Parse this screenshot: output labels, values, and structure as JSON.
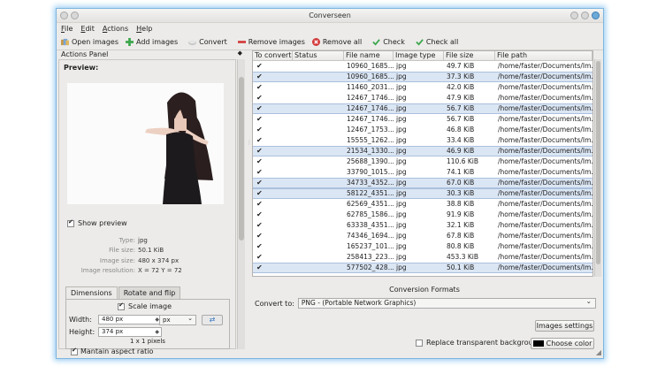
{
  "window": {
    "title": "Converseen"
  },
  "menu": [
    "File",
    "Edit",
    "Actions",
    "Help"
  ],
  "toolbar": {
    "open_images": "Open images",
    "add_images": "Add images",
    "convert": "Convert",
    "remove_images": "Remove images",
    "remove_all": "Remove all",
    "check": "Check",
    "check_all": "Check all"
  },
  "actions_panel": {
    "title": "Actions Panel",
    "preview_label": "Preview:",
    "show_preview": "Show preview",
    "show_preview_checked": true,
    "info": [
      {
        "key": "Type:",
        "value": "jpg"
      },
      {
        "key": "File size:",
        "value": "50.1 KiB"
      },
      {
        "key": "Image size:",
        "value": "480 x 374 px"
      },
      {
        "key": "Image resolution:",
        "value": "X = 72 Y = 72"
      }
    ],
    "tabs": [
      "Dimensions",
      "Rotate and flip"
    ],
    "scale_image": "Scale image",
    "width_label": "Width:",
    "width_value": "480 px",
    "height_label": "Height:",
    "height_value": "374 px",
    "unit": "px",
    "pixels_note": "1 x 1 pixels",
    "maintain_aspect": "Mantain aspect ratio"
  },
  "table": {
    "columns": [
      "To convert",
      "Status",
      "File name",
      "Image type",
      "File size",
      "File path"
    ],
    "rows": [
      {
        "file": "10960_1685...",
        "type": "jpg",
        "size": "49.7 KiB",
        "path": "/home/faster/Documents/Im...",
        "selected": false
      },
      {
        "file": "10960_1685...",
        "type": "jpg",
        "size": "37.3 KiB",
        "path": "/home/faster/Documents/Im...",
        "selected": true
      },
      {
        "file": "11460_2031...",
        "type": "jpg",
        "size": "42.0 KiB",
        "path": "/home/faster/Documents/Im...",
        "selected": false
      },
      {
        "file": "12467_1746...",
        "type": "jpg",
        "size": "47.9 KiB",
        "path": "/home/faster/Documents/Im...",
        "selected": false
      },
      {
        "file": "12467_1746...",
        "type": "jpg",
        "size": "56.7 KiB",
        "path": "/home/faster/Documents/Im...",
        "selected": true
      },
      {
        "file": "12467_1746...",
        "type": "jpg",
        "size": "56.7 KiB",
        "path": "/home/faster/Documents/Im...",
        "selected": false
      },
      {
        "file": "12467_1753...",
        "type": "jpg",
        "size": "46.8 KiB",
        "path": "/home/faster/Documents/Im...",
        "selected": false
      },
      {
        "file": "15555_1262...",
        "type": "jpg",
        "size": "33.4 KiB",
        "path": "/home/faster/Documents/Im...",
        "selected": false
      },
      {
        "file": "21534_1330...",
        "type": "jpg",
        "size": "46.9 KiB",
        "path": "/home/faster/Documents/Im...",
        "selected": true
      },
      {
        "file": "25688_1390...",
        "type": "jpg",
        "size": "110.6 KiB",
        "path": "/home/faster/Documents/Im...",
        "selected": false
      },
      {
        "file": "33790_1015...",
        "type": "jpg",
        "size": "74.1 KiB",
        "path": "/home/faster/Documents/Im...",
        "selected": false
      },
      {
        "file": "34733_4352...",
        "type": "jpg",
        "size": "67.0 KiB",
        "path": "/home/faster/Documents/Im...",
        "selected": true
      },
      {
        "file": "58122_4351...",
        "type": "jpg",
        "size": "30.3 KiB",
        "path": "/home/faster/Documents/Im...",
        "selected": true
      },
      {
        "file": "62569_4351...",
        "type": "jpg",
        "size": "38.8 KiB",
        "path": "/home/faster/Documents/Im...",
        "selected": false
      },
      {
        "file": "62785_1586...",
        "type": "jpg",
        "size": "91.9 KiB",
        "path": "/home/faster/Documents/Im...",
        "selected": false
      },
      {
        "file": "63338_4351...",
        "type": "jpg",
        "size": "32.1 KiB",
        "path": "/home/faster/Documents/Im...",
        "selected": false
      },
      {
        "file": "74346_1694...",
        "type": "jpg",
        "size": "67.8 KiB",
        "path": "/home/faster/Documents/Im...",
        "selected": false
      },
      {
        "file": "165237_101...",
        "type": "jpg",
        "size": "80.8 KiB",
        "path": "/home/faster/Documents/Im...",
        "selected": false
      },
      {
        "file": "258413_223...",
        "type": "jpg",
        "size": "453.3 KiB",
        "path": "/home/faster/Documents/Im...",
        "selected": false
      },
      {
        "file": "577502_428...",
        "type": "jpg",
        "size": "50.1 KiB",
        "path": "/home/faster/Documents/Im...",
        "selected": true
      }
    ]
  },
  "conversion": {
    "header": "Conversion Formats",
    "convert_to_label": "Convert to:",
    "format": "PNG - (Portable Network Graphics)",
    "image_settings": "Images settings",
    "replace_transparent": "Replace transparent background",
    "choose_color": "Choose color"
  },
  "colors": {
    "accent": "#3a78c2",
    "selection": "#dbe6f4",
    "window_glow": "#9fd0f3"
  }
}
